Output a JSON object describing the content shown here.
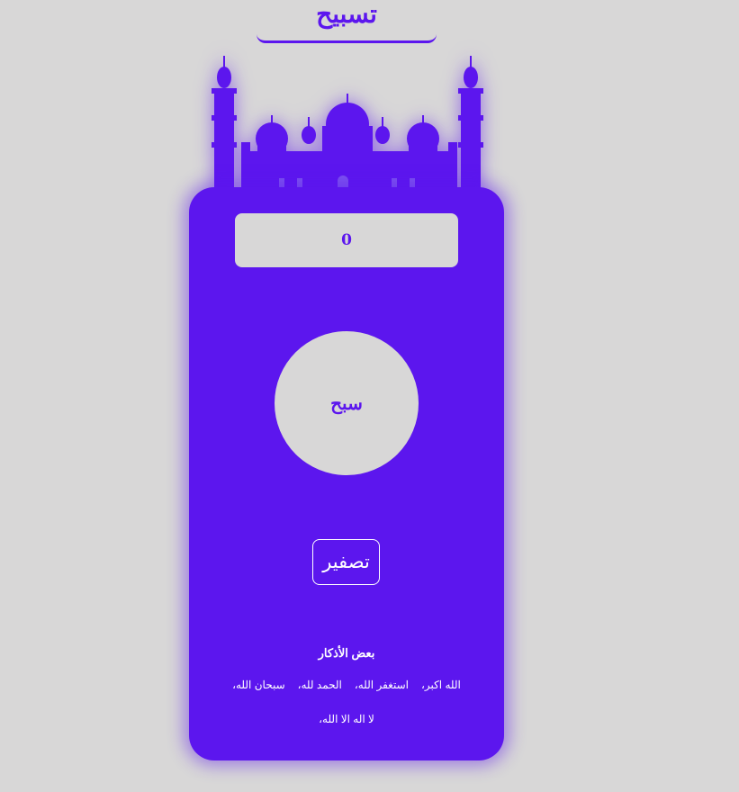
{
  "header": {
    "title": "تسبيح"
  },
  "counter": {
    "value": "0"
  },
  "buttons": {
    "tasbih_label": "سبح",
    "reset_label": "تصفير"
  },
  "athkar": {
    "heading": "بعض الأذكار",
    "row1": [
      "الله اكبر،",
      "استغفر الله،",
      "الحمد لله،",
      "سبحان الله،"
    ],
    "row2": [
      "لا اله الا الله،"
    ]
  },
  "colors": {
    "accent": "#5c16ee",
    "background": "#d8d7d7",
    "text_light": "#ffffff"
  }
}
